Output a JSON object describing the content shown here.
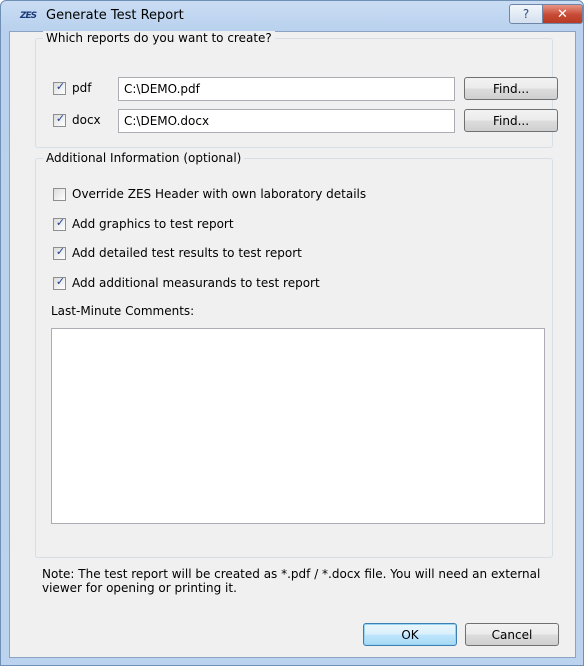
{
  "window": {
    "logo": "ZES",
    "title": "Generate Test Report",
    "help_glyph": "?",
    "close_glyph": "✕"
  },
  "reports": {
    "legend": "Which reports do you want to create?",
    "rows": [
      {
        "label": "pdf",
        "checked": true,
        "path": "C:\\DEMO.pdf",
        "find": "Find..."
      },
      {
        "label": "docx",
        "checked": true,
        "path": "C:\\DEMO.docx",
        "find": "Find..."
      }
    ]
  },
  "additional": {
    "legend": "Additional Information (optional)",
    "options": [
      {
        "label": "Override ZES Header with own laboratory details",
        "checked": false
      },
      {
        "label": "Add graphics to test report",
        "checked": true
      },
      {
        "label": "Add detailed test results to test report",
        "checked": true
      },
      {
        "label": "Add additional measurands to test report",
        "checked": true
      }
    ],
    "comments_label": "Last-Minute Comments:",
    "comments_value": ""
  },
  "note": "Note: The test report will be created as *.pdf / *.docx file. You will need an external viewer for opening or printing it.",
  "buttons": {
    "ok": "OK",
    "cancel": "Cancel"
  },
  "check_glyph": "✓"
}
